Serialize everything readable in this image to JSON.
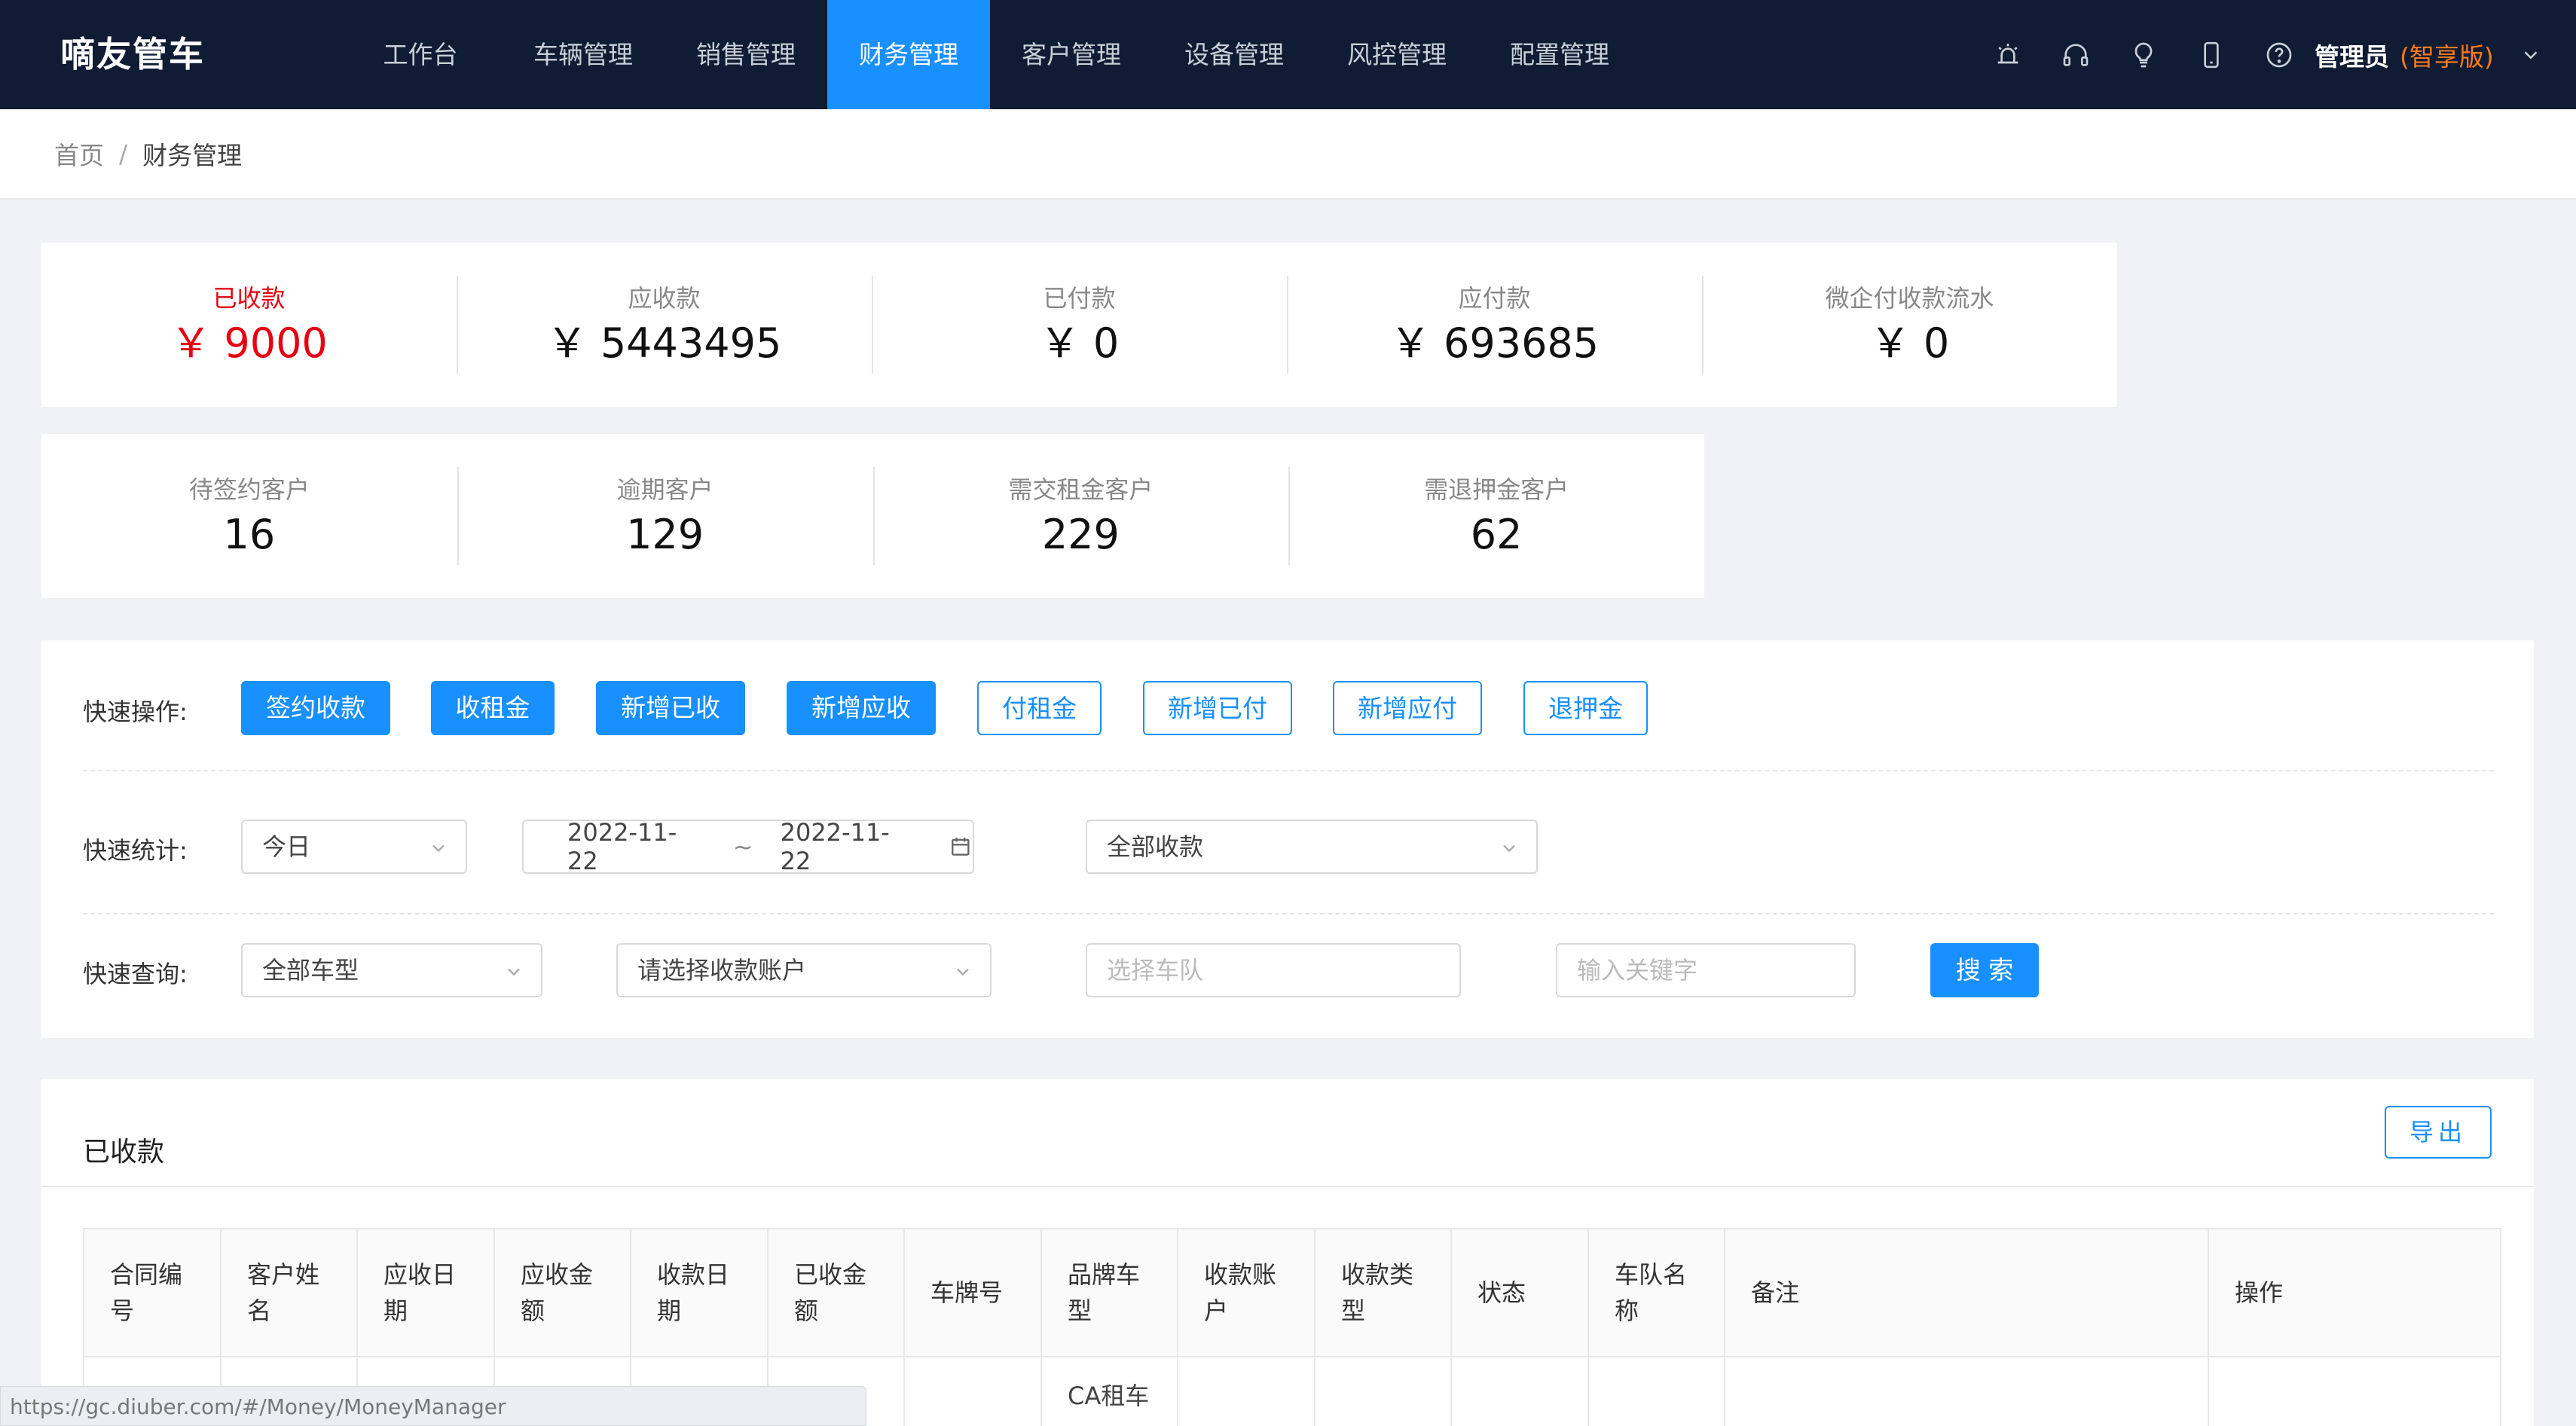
{
  "app": {
    "logo": "嘀友管车"
  },
  "nav": [
    {
      "label": "工作台"
    },
    {
      "label": "车辆管理"
    },
    {
      "label": "销售管理"
    },
    {
      "label": "财务管理",
      "active": true
    },
    {
      "label": "客户管理"
    },
    {
      "label": "设备管理"
    },
    {
      "label": "风控管理"
    },
    {
      "label": "配置管理"
    }
  ],
  "header_icons": [
    "alarm-icon",
    "headset-icon",
    "lightbulb-icon",
    "mobile-icon",
    "help-icon"
  ],
  "user": {
    "name": "管理员",
    "edition": "(智享版)"
  },
  "breadcrumb": {
    "home": "首页",
    "sep": "/",
    "current": "财务管理"
  },
  "stats_top": [
    {
      "label": "已收款",
      "value": "￥ 9000",
      "highlight": true
    },
    {
      "label": "应收款",
      "value": "￥ 5443495"
    },
    {
      "label": "已付款",
      "value": "￥ 0"
    },
    {
      "label": "应付款",
      "value": "￥ 693685"
    },
    {
      "label": "微企付收款流水",
      "value": "￥ 0"
    }
  ],
  "stats_customers": [
    {
      "label": "待签约客户",
      "value": "16"
    },
    {
      "label": "逾期客户",
      "value": "129"
    },
    {
      "label": "需交租金客户",
      "value": "229"
    },
    {
      "label": "需退押金客户",
      "value": "62"
    }
  ],
  "quick_ops": {
    "label": "快速操作:",
    "buttons": [
      {
        "label": "签约收款",
        "style": "primary"
      },
      {
        "label": "收租金",
        "style": "primary"
      },
      {
        "label": "新增已收",
        "style": "primary"
      },
      {
        "label": "新增应收",
        "style": "primary"
      },
      {
        "label": "付租金",
        "style": "plain"
      },
      {
        "label": "新增已付",
        "style": "plain"
      },
      {
        "label": "新增应付",
        "style": "plain"
      },
      {
        "label": "退押金",
        "style": "plain"
      }
    ]
  },
  "quick_stats": {
    "label": "快速统计:",
    "period": "今日",
    "date_start": "2022-11-22",
    "date_sep": "~",
    "date_end": "2022-11-22",
    "receipt_type": "全部收款"
  },
  "quick_query": {
    "label": "快速查询:",
    "car_type": "全部车型",
    "account_placeholder": "请选择收款账户",
    "fleet_placeholder": "选择车队",
    "keyword_placeholder": "输入关键字",
    "search_label": "搜 索"
  },
  "table": {
    "title": "已收款",
    "export_label": "导出",
    "columns": [
      "合同编\n号",
      "客户姓\n名",
      "应收日\n期",
      "应收金\n额",
      "收款日\n期",
      "已收金\n额",
      "车牌号",
      "品牌车\n型",
      "收款账\n户",
      "收款类\n型",
      "状态",
      "车队名\n称",
      "备注",
      "操作"
    ],
    "first_row_brand": "CA租车"
  },
  "status_url": "https://gc.diuber.com/#/Money/MoneyManager",
  "colors": {
    "topbar": "#0f1c33",
    "accent": "#1890ff",
    "highlight": "#e60012",
    "edition": "#ff7a1a"
  }
}
